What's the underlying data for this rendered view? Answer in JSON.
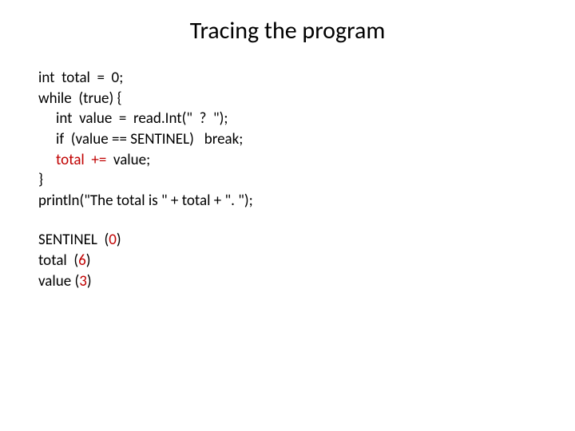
{
  "title": "Tracing the program",
  "code": {
    "l1": "int  total  =  0;",
    "l2": "while  (true) {",
    "l3": "int  value  =  read.Int(\"  ?  \");",
    "l4": "if  (value == SENTINEL)   break;",
    "l5_a": "total  += ",
    "l5_b": " value;",
    "l6": "}",
    "l7": "println(\"The total is \" + total + \". \");"
  },
  "vars": {
    "v1_a": "SENTINEL  (",
    "v1_b": "0",
    "v1_c": ")",
    "v2_a": "total  (",
    "v2_b": "6",
    "v2_c": ")",
    "v3_a": "value (",
    "v3_b": "3",
    "v3_c": ")"
  }
}
